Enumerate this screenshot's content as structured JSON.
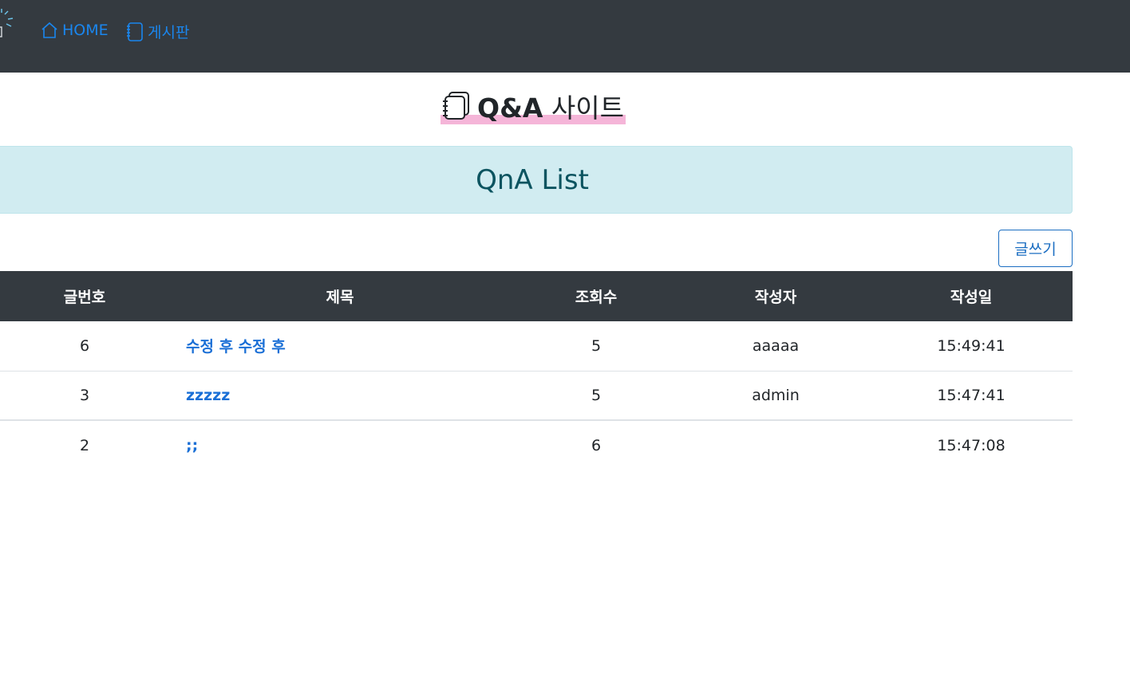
{
  "nav": {
    "home_label": "HOME",
    "board_label": "게시판",
    "link_color": "#1a86ee"
  },
  "site": {
    "title_bold": "Q&A",
    "title_normal": "사이트"
  },
  "banner": {
    "heading": "QnA List",
    "color": "#0c5460",
    "background": "#d1ecf1"
  },
  "actions": {
    "write_label": "글쓰기"
  },
  "table": {
    "headers": [
      "글번호",
      "제목",
      "조회수",
      "작성자",
      "작성일"
    ],
    "rows": [
      {
        "no": "6",
        "title": "수정 후 수정 후",
        "views": "5",
        "author": "aaaaa",
        "date": "15:49:41"
      },
      {
        "no": "3",
        "title": "zzzzz",
        "views": "5",
        "author": "admin",
        "date": "15:47:41"
      },
      {
        "no": "2",
        "title": ";;",
        "views": "6",
        "author": "",
        "date": "15:47:08"
      }
    ]
  }
}
